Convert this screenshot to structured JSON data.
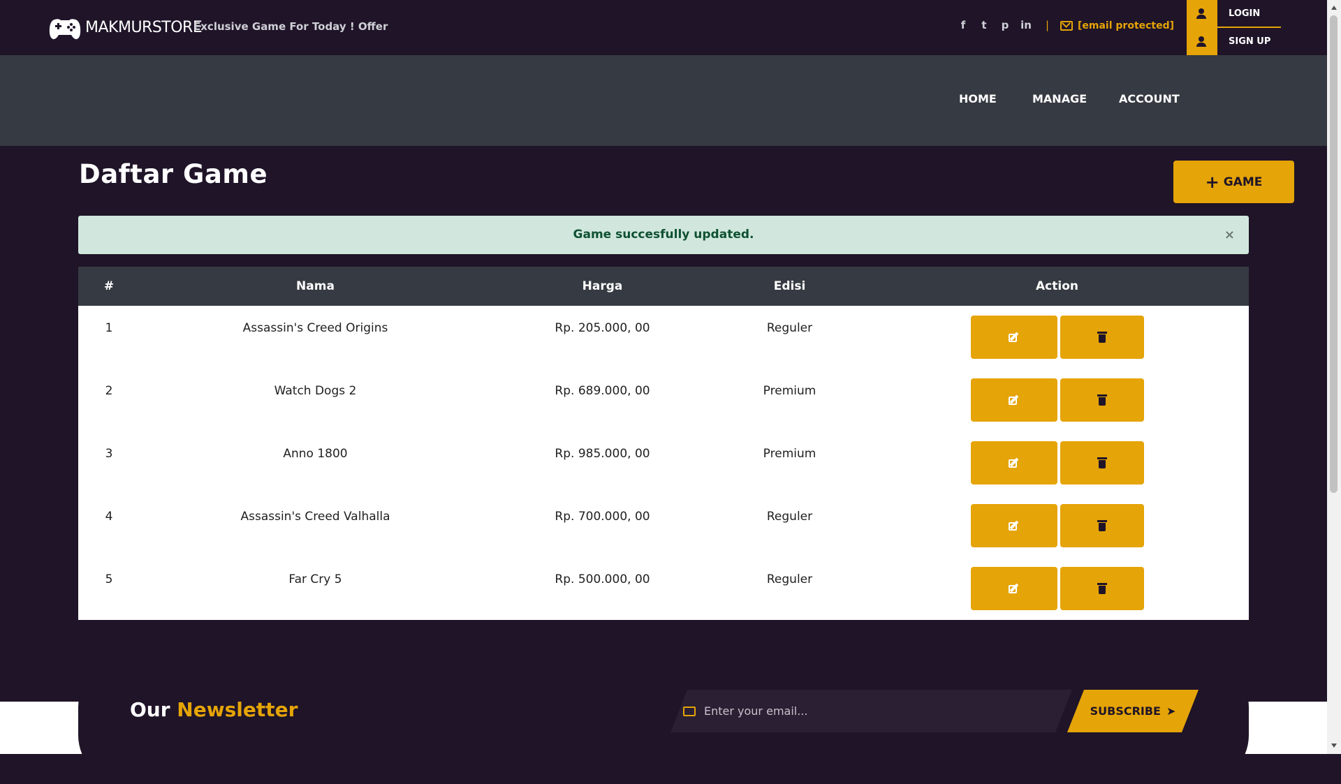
{
  "header": {
    "brand": "MAKMURSTORE",
    "tagline": "Exclusive Game For Today ! Offer",
    "socials": [
      "f",
      "t",
      "p",
      "in"
    ],
    "separator": "|",
    "email": "[email protected]",
    "login_label": "LOGIN",
    "signup_label": "SIGN UP"
  },
  "nav": {
    "items": [
      "HOME",
      "MANAGE",
      "ACCOUNT"
    ]
  },
  "main": {
    "title": "Daftar Game",
    "add_button": "GAME",
    "alert": "Game succesfully updated.",
    "alert_close": "×",
    "table": {
      "columns": [
        "#",
        "Nama",
        "Harga",
        "Edisi",
        "Action"
      ],
      "rows": [
        {
          "no": "1",
          "nama": "Assassin's Creed Origins",
          "harga": "Rp. 205.000, 00",
          "edisi": "Reguler"
        },
        {
          "no": "2",
          "nama": "Watch Dogs 2",
          "harga": "Rp. 689.000, 00",
          "edisi": "Premium"
        },
        {
          "no": "3",
          "nama": "Anno 1800",
          "harga": "Rp. 985.000, 00",
          "edisi": "Premium"
        },
        {
          "no": "4",
          "nama": "Assassin's Creed Valhalla",
          "harga": "Rp. 700.000, 00",
          "edisi": "Reguler"
        },
        {
          "no": "5",
          "nama": "Far Cry 5",
          "harga": "Rp. 500.000, 00",
          "edisi": "Reguler"
        }
      ]
    }
  },
  "newsletter": {
    "title_prefix": "Our",
    "title_highlight": "Newsletter",
    "placeholder": "Enter your email...",
    "button": "SUBSCRIBE"
  },
  "colors": {
    "accent": "#e5a407",
    "background": "#1f1428",
    "nav_band": "#363a42",
    "alert_bg": "#d1e7dd",
    "alert_text": "#0f5132"
  }
}
